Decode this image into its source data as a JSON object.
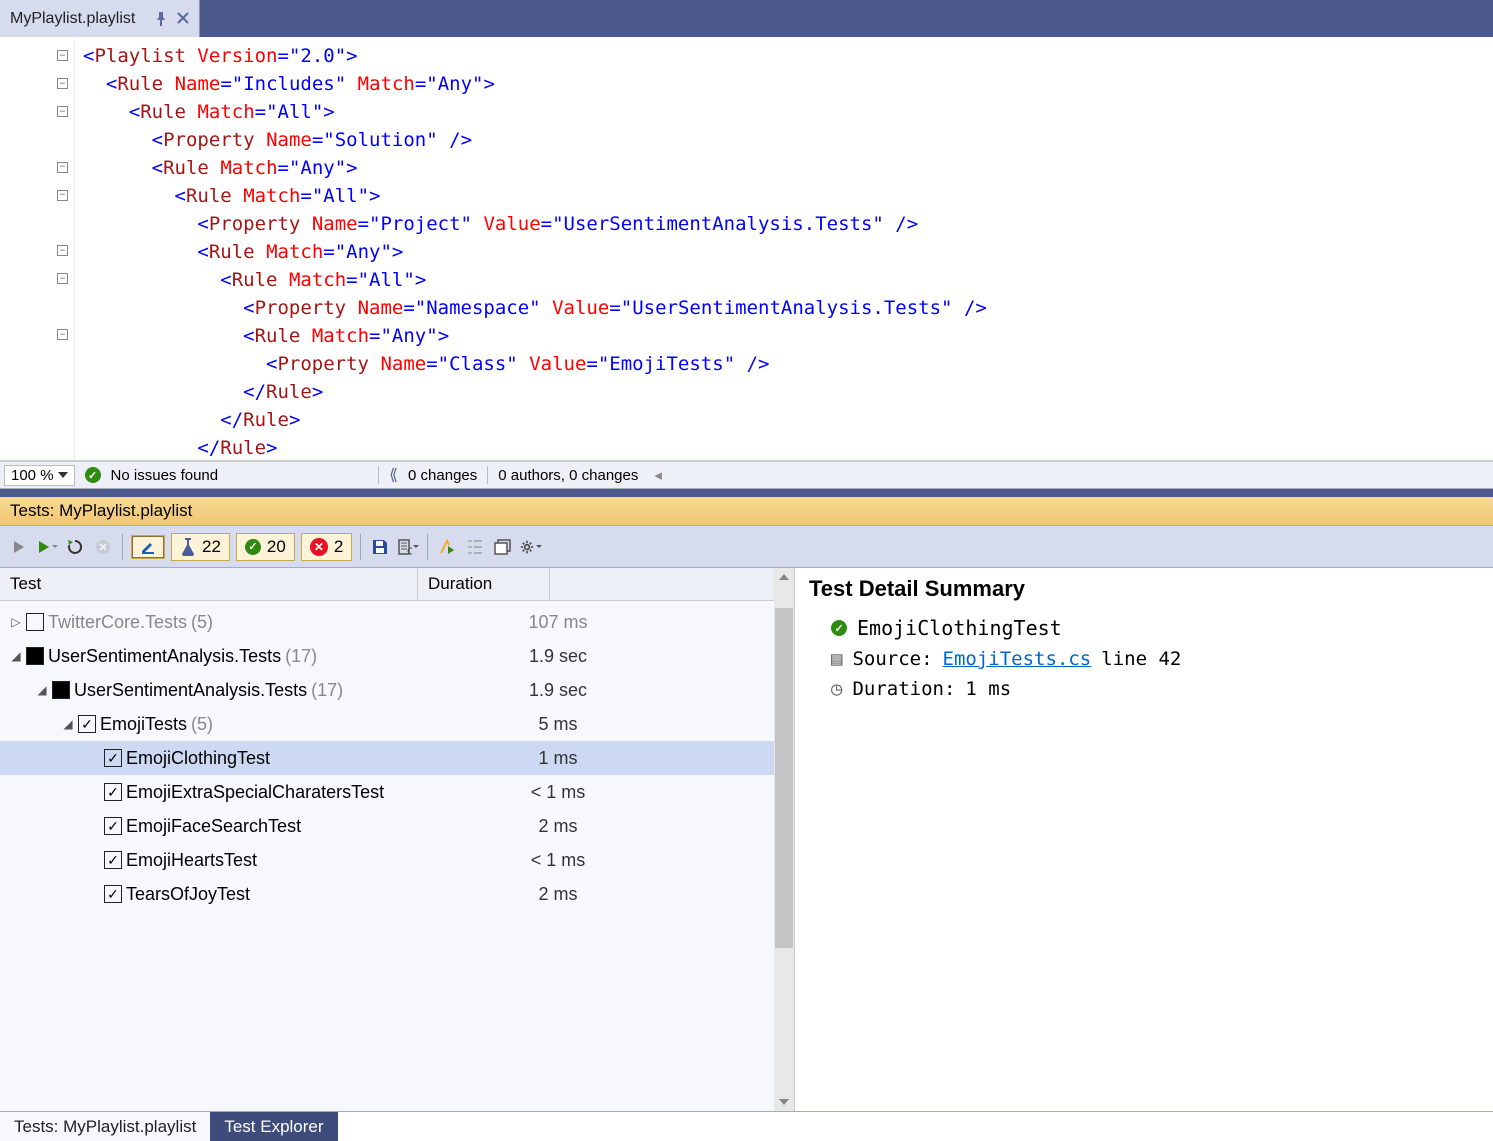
{
  "tab": {
    "filename": "MyPlaylist.playlist"
  },
  "code_lines": [
    [
      {
        "c": "t-br",
        "t": "<"
      },
      {
        "c": "t-el",
        "t": "Playlist"
      },
      {
        "c": "",
        "t": " "
      },
      {
        "c": "t-at",
        "t": "Version"
      },
      {
        "c": "t-br",
        "t": "="
      },
      {
        "c": "t-st",
        "t": "\"2.0\""
      },
      {
        "c": "t-br",
        "t": ">"
      }
    ],
    [
      {
        "c": "",
        "t": "  "
      },
      {
        "c": "t-br",
        "t": "<"
      },
      {
        "c": "t-el",
        "t": "Rule"
      },
      {
        "c": "",
        "t": " "
      },
      {
        "c": "t-at",
        "t": "Name"
      },
      {
        "c": "t-br",
        "t": "="
      },
      {
        "c": "t-st",
        "t": "\"Includes\""
      },
      {
        "c": "",
        "t": " "
      },
      {
        "c": "t-at",
        "t": "Match"
      },
      {
        "c": "t-br",
        "t": "="
      },
      {
        "c": "t-st",
        "t": "\"Any\""
      },
      {
        "c": "t-br",
        "t": ">"
      }
    ],
    [
      {
        "c": "",
        "t": "    "
      },
      {
        "c": "t-br",
        "t": "<"
      },
      {
        "c": "t-el",
        "t": "Rule"
      },
      {
        "c": "",
        "t": " "
      },
      {
        "c": "t-at",
        "t": "Match"
      },
      {
        "c": "t-br",
        "t": "="
      },
      {
        "c": "t-st",
        "t": "\"All\""
      },
      {
        "c": "t-br",
        "t": ">"
      }
    ],
    [
      {
        "c": "",
        "t": "      "
      },
      {
        "c": "t-br",
        "t": "<"
      },
      {
        "c": "t-el",
        "t": "Property"
      },
      {
        "c": "",
        "t": " "
      },
      {
        "c": "t-at",
        "t": "Name"
      },
      {
        "c": "t-br",
        "t": "="
      },
      {
        "c": "t-st",
        "t": "\"Solution\""
      },
      {
        "c": "",
        "t": " "
      },
      {
        "c": "t-br",
        "t": "/>"
      }
    ],
    [
      {
        "c": "",
        "t": "      "
      },
      {
        "c": "t-br",
        "t": "<"
      },
      {
        "c": "t-el",
        "t": "Rule"
      },
      {
        "c": "",
        "t": " "
      },
      {
        "c": "t-at",
        "t": "Match"
      },
      {
        "c": "t-br",
        "t": "="
      },
      {
        "c": "t-st",
        "t": "\"Any\""
      },
      {
        "c": "t-br",
        "t": ">"
      }
    ],
    [
      {
        "c": "",
        "t": "        "
      },
      {
        "c": "t-br",
        "t": "<"
      },
      {
        "c": "t-el",
        "t": "Rule"
      },
      {
        "c": "",
        "t": " "
      },
      {
        "c": "t-at",
        "t": "Match"
      },
      {
        "c": "t-br",
        "t": "="
      },
      {
        "c": "t-st",
        "t": "\"All\""
      },
      {
        "c": "t-br",
        "t": ">"
      }
    ],
    [
      {
        "c": "",
        "t": "          "
      },
      {
        "c": "t-br",
        "t": "<"
      },
      {
        "c": "t-el",
        "t": "Property"
      },
      {
        "c": "",
        "t": " "
      },
      {
        "c": "t-at",
        "t": "Name"
      },
      {
        "c": "t-br",
        "t": "="
      },
      {
        "c": "t-st",
        "t": "\"Project\""
      },
      {
        "c": "",
        "t": " "
      },
      {
        "c": "t-at",
        "t": "Value"
      },
      {
        "c": "t-br",
        "t": "="
      },
      {
        "c": "t-st",
        "t": "\"UserSentimentAnalysis.Tests\""
      },
      {
        "c": "",
        "t": " "
      },
      {
        "c": "t-br",
        "t": "/>"
      }
    ],
    [
      {
        "c": "",
        "t": "          "
      },
      {
        "c": "t-br",
        "t": "<"
      },
      {
        "c": "t-el",
        "t": "Rule"
      },
      {
        "c": "",
        "t": " "
      },
      {
        "c": "t-at",
        "t": "Match"
      },
      {
        "c": "t-br",
        "t": "="
      },
      {
        "c": "t-st",
        "t": "\"Any\""
      },
      {
        "c": "t-br",
        "t": ">"
      }
    ],
    [
      {
        "c": "",
        "t": "            "
      },
      {
        "c": "t-br",
        "t": "<"
      },
      {
        "c": "t-el",
        "t": "Rule"
      },
      {
        "c": "",
        "t": " "
      },
      {
        "c": "t-at",
        "t": "Match"
      },
      {
        "c": "t-br",
        "t": "="
      },
      {
        "c": "t-st",
        "t": "\"All\""
      },
      {
        "c": "t-br",
        "t": ">"
      }
    ],
    [
      {
        "c": "",
        "t": "              "
      },
      {
        "c": "t-br",
        "t": "<"
      },
      {
        "c": "t-el",
        "t": "Property"
      },
      {
        "c": "",
        "t": " "
      },
      {
        "c": "t-at",
        "t": "Name"
      },
      {
        "c": "t-br",
        "t": "="
      },
      {
        "c": "t-st",
        "t": "\"Namespace\""
      },
      {
        "c": "",
        "t": " "
      },
      {
        "c": "t-at",
        "t": "Value"
      },
      {
        "c": "t-br",
        "t": "="
      },
      {
        "c": "t-st",
        "t": "\"UserSentimentAnalysis.Tests\""
      },
      {
        "c": "",
        "t": " "
      },
      {
        "c": "t-br",
        "t": "/>"
      }
    ],
    [
      {
        "c": "",
        "t": "              "
      },
      {
        "c": "t-br",
        "t": "<"
      },
      {
        "c": "t-el",
        "t": "Rule"
      },
      {
        "c": "",
        "t": " "
      },
      {
        "c": "t-at",
        "t": "Match"
      },
      {
        "c": "t-br",
        "t": "="
      },
      {
        "c": "t-st",
        "t": "\"Any\""
      },
      {
        "c": "t-br",
        "t": ">"
      }
    ],
    [
      {
        "c": "",
        "t": "                "
      },
      {
        "c": "t-br",
        "t": "<"
      },
      {
        "c": "t-el",
        "t": "Property"
      },
      {
        "c": "",
        "t": " "
      },
      {
        "c": "t-at",
        "t": "Name"
      },
      {
        "c": "t-br",
        "t": "="
      },
      {
        "c": "t-st",
        "t": "\"Class\""
      },
      {
        "c": "",
        "t": " "
      },
      {
        "c": "t-at",
        "t": "Value"
      },
      {
        "c": "t-br",
        "t": "="
      },
      {
        "c": "t-st",
        "t": "\"EmojiTests\""
      },
      {
        "c": "",
        "t": " "
      },
      {
        "c": "t-br",
        "t": "/>"
      }
    ],
    [
      {
        "c": "",
        "t": "              "
      },
      {
        "c": "t-br",
        "t": "</"
      },
      {
        "c": "t-el",
        "t": "Rule"
      },
      {
        "c": "t-br",
        "t": ">"
      }
    ],
    [
      {
        "c": "",
        "t": "            "
      },
      {
        "c": "t-br",
        "t": "</"
      },
      {
        "c": "t-el",
        "t": "Rule"
      },
      {
        "c": "t-br",
        "t": ">"
      }
    ],
    [
      {
        "c": "",
        "t": "          "
      },
      {
        "c": "t-br",
        "t": "</"
      },
      {
        "c": "t-el",
        "t": "Rule"
      },
      {
        "c": "t-br",
        "t": ">"
      }
    ]
  ],
  "fold_rows": [
    0,
    1,
    2,
    4,
    5,
    7,
    8,
    10
  ],
  "status": {
    "zoom": "100 %",
    "issues": "No issues found",
    "changes": "0 changes",
    "authors": "0 authors, 0 changes"
  },
  "tests_panel": {
    "header": "Tests: MyPlaylist.playlist",
    "counters": {
      "total": "22",
      "passed": "20",
      "failed": "2"
    },
    "columns": {
      "test": "Test",
      "duration": "Duration"
    },
    "rows": [
      {
        "indent": 0,
        "exp": "▷",
        "chk": "empty",
        "name": "TwitterCore.Tests",
        "count": "(5)",
        "dim": true,
        "dur": "107 ms"
      },
      {
        "indent": 0,
        "exp": "◢",
        "chk": "partial",
        "name": "UserSentimentAnalysis.Tests",
        "count": "(17)",
        "dur": "1.9 sec"
      },
      {
        "indent": 1,
        "exp": "◢",
        "chk": "partial",
        "name": "UserSentimentAnalysis.Tests",
        "count": "(17)",
        "dur": "1.9 sec"
      },
      {
        "indent": 2,
        "exp": "◢",
        "chk": "checked",
        "name": "EmojiTests",
        "count": "(5)",
        "dur": "5 ms"
      },
      {
        "indent": 3,
        "exp": "",
        "chk": "checked",
        "name": "EmojiClothingTest",
        "count": "",
        "dur": "1 ms",
        "sel": true
      },
      {
        "indent": 3,
        "exp": "",
        "chk": "checked",
        "name": "EmojiExtraSpecialCharatersTest",
        "count": "",
        "dur": "< 1 ms"
      },
      {
        "indent": 3,
        "exp": "",
        "chk": "checked",
        "name": "EmojiFaceSearchTest",
        "count": "",
        "dur": "2 ms"
      },
      {
        "indent": 3,
        "exp": "",
        "chk": "checked",
        "name": "EmojiHeartsTest",
        "count": "",
        "dur": "< 1 ms"
      },
      {
        "indent": 3,
        "exp": "",
        "chk": "checked",
        "name": "TearsOfJoyTest",
        "count": "",
        "dur": "2 ms"
      }
    ]
  },
  "detail": {
    "title": "Test Detail Summary",
    "test_name": "EmojiClothingTest",
    "source_label": "Source:",
    "source_file": "EmojiTests.cs",
    "source_line": "line 42",
    "duration_label": "Duration:",
    "duration_value": "1 ms"
  },
  "bottom_tabs": [
    {
      "label": "Tests: MyPlaylist.playlist",
      "active": true
    },
    {
      "label": "Test Explorer",
      "active": false
    }
  ]
}
